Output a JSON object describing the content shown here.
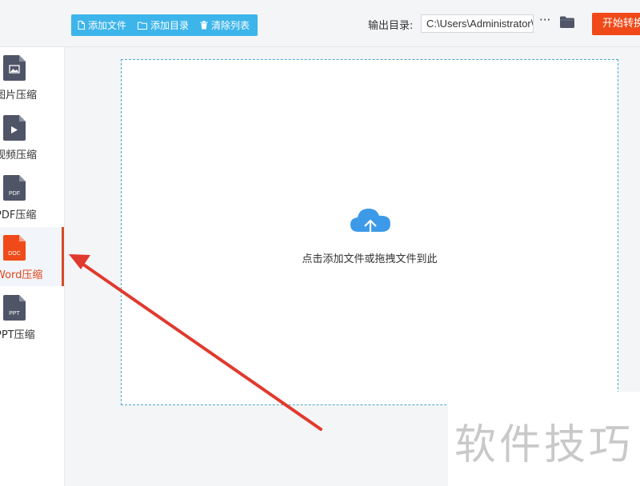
{
  "toolbar": {
    "add_file": "添加文件",
    "add_folder": "添加目录",
    "clear_list": "清除列表"
  },
  "output": {
    "label": "输出目录:",
    "path": "C:\\Users\\Administrator\\",
    "more": "···"
  },
  "start_button": "开始转换",
  "sidebar": {
    "items": [
      {
        "label": "图片压缩",
        "icon": "image-file-icon",
        "active": false
      },
      {
        "label": "视频压缩",
        "icon": "video-file-icon",
        "active": false
      },
      {
        "label": "PDF压缩",
        "icon_text": "PDF",
        "icon": "pdf-file-icon",
        "active": false
      },
      {
        "label": "Word压缩",
        "icon_text": "DOC",
        "icon": "doc-file-icon",
        "active": true
      },
      {
        "label": "PPT压缩",
        "icon_text": "PPT",
        "icon": "ppt-file-icon",
        "active": false
      }
    ]
  },
  "dropzone": {
    "hint": "点击添加文件或拖拽文件到此",
    "icon": "cloud-upload-icon"
  },
  "watermark": "软件技巧",
  "colors": {
    "toolbar_bg": "#3db5eb",
    "start_button": "#f04a1a",
    "active_accent": "#e0461d",
    "file_icon": "#4f5567",
    "cloud": "#3d9ae8",
    "arrow": "#e03a2e"
  }
}
